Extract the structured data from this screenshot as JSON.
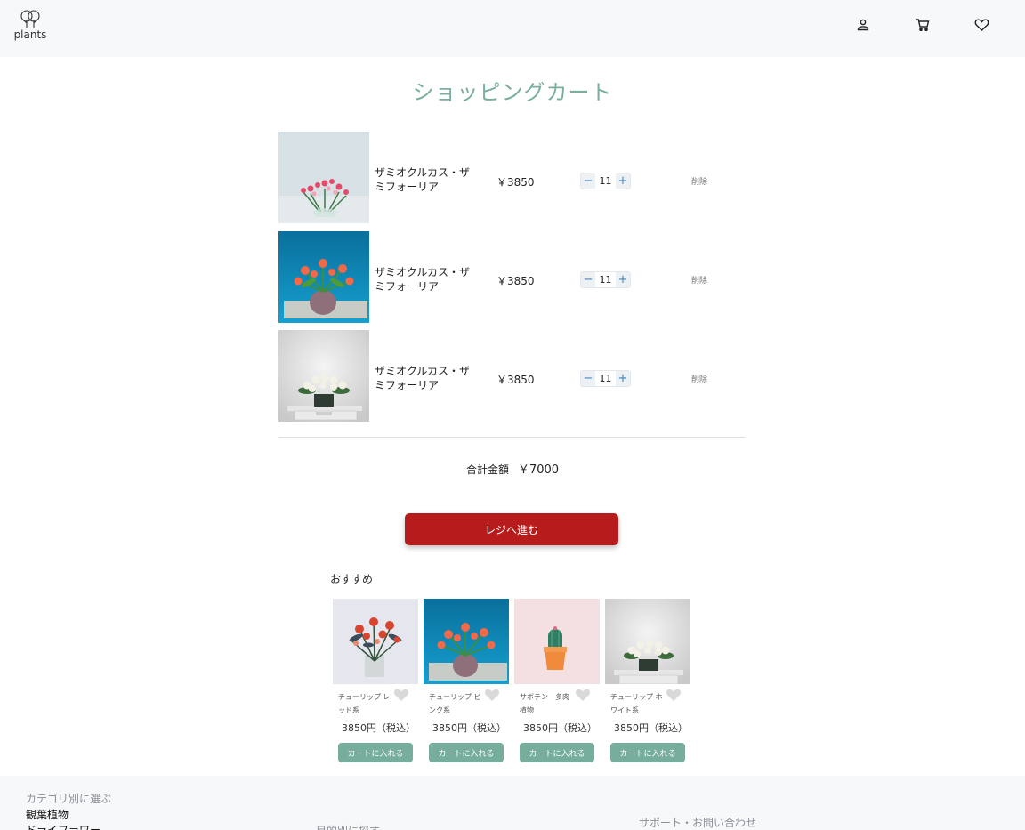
{
  "header": {
    "logo_text": "plants",
    "icons": [
      "user-icon",
      "cart-icon",
      "heart-icon"
    ]
  },
  "page": {
    "title": "ショッピングカート"
  },
  "cart": {
    "items": [
      {
        "name": "ザミオクルカス・ザミフォーリア",
        "price": "￥3850",
        "qty": "11",
        "delete": "削除",
        "minus": "−",
        "plus": "+"
      },
      {
        "name": "ザミオクルカス・ザミフォーリア",
        "price": "￥3850",
        "qty": "11",
        "delete": "削除",
        "minus": "−",
        "plus": "+"
      },
      {
        "name": "ザミオクルカス・ザミフォーリア",
        "price": "￥3850",
        "qty": "11",
        "delete": "削除",
        "minus": "−",
        "plus": "+"
      }
    ],
    "total_label": "合計金額",
    "total_value": "￥7000",
    "checkout_label": "レジへ進む"
  },
  "recommend": {
    "title": "おすすめ",
    "items": [
      {
        "name": "チューリップ レッド系",
        "price": "3850円（税込）",
        "button": "カートに入れる"
      },
      {
        "name": "チューリップ ピンク系",
        "price": "3850円（税込）",
        "button": "カートに入れる"
      },
      {
        "name": "サボテン　多肉植物",
        "price": "3850円（税込）",
        "button": "カートに入れる"
      },
      {
        "name": "チューリップ ホワイト系",
        "price": "3850円（税込）",
        "button": "カートに入れる"
      }
    ]
  },
  "footer": {
    "category_heading": "カテゴリ別に選ぶ",
    "category_links": [
      "観葉植物",
      "ドライフラワー"
    ],
    "purpose_heading": "目的別に探す",
    "support_heading": "サポート・お問い合わせ"
  },
  "colors": {
    "accent": "#7aaea0",
    "checkout": "#b71c1c",
    "cart_button": "#77ad9d",
    "header_bg": "#f7f8fa"
  }
}
